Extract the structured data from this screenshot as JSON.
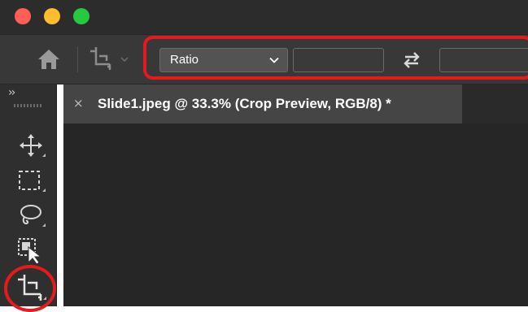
{
  "window": {
    "traffic_lights": [
      {
        "name": "close",
        "color": "#ff5f57"
      },
      {
        "name": "minimize",
        "color": "#febc2e"
      },
      {
        "name": "zoom",
        "color": "#28c840"
      }
    ]
  },
  "options_bar": {
    "icons": [
      "home-icon",
      "crop-tool-icon",
      "chevron-down-icon",
      "swap-icon"
    ],
    "ratio_select": {
      "value": "Ratio"
    },
    "width_field": {
      "value": ""
    },
    "height_field": {
      "value": ""
    }
  },
  "toolbar": {
    "collapse_label": "››",
    "tools": [
      "move-tool-icon",
      "marquee-tool-icon",
      "lasso-tool-icon",
      "object-select-tool-icon",
      "crop-tool-icon"
    ]
  },
  "document_tab": {
    "close_glyph": "×",
    "title": "Slide1.jpeg @ 33.3% (Crop Preview, RGB/8) *"
  },
  "annotations": {
    "color": "#e41a1c"
  }
}
